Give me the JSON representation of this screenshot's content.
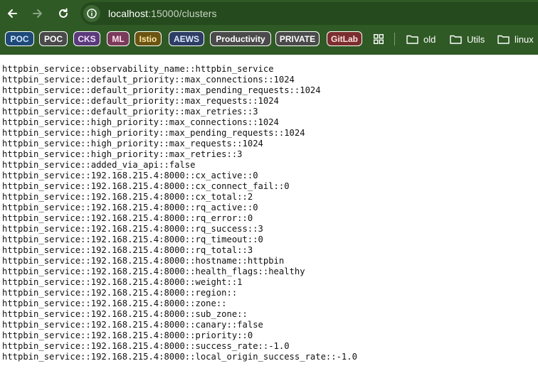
{
  "browser": {
    "url_host": "localhost",
    "url_path": ":15000/clusters",
    "bookmarks": [
      {
        "label": "POC",
        "bg": "#1f4a78",
        "fg": "#cfe3ff"
      },
      {
        "label": "POC",
        "bg": "#4a4a4a",
        "fg": "#ffffff"
      },
      {
        "label": "CKS",
        "bg": "#5a3a7a",
        "fg": "#f0e0ff"
      },
      {
        "label": "ML",
        "bg": "#7a3a5a",
        "fg": "#ffe0f0"
      },
      {
        "label": "Istio",
        "bg": "#6b5412",
        "fg": "#ffe7a6"
      },
      {
        "label": "AEWS",
        "bg": "#2d3d63",
        "fg": "#dfe8ff"
      },
      {
        "label": "Productivity",
        "bg": "#4a4a4a",
        "fg": "#ffffff"
      },
      {
        "label": "PRIVATE",
        "bg": "#4a4a4a",
        "fg": "#ffffff"
      },
      {
        "label": "GitLab",
        "bg": "#7a2e2e",
        "fg": "#ffe0e0"
      }
    ],
    "folders": [
      {
        "label": "old"
      },
      {
        "label": "Utils"
      },
      {
        "label": "linux"
      }
    ],
    "icons": [
      "back-arrow-icon",
      "forward-arrow-icon",
      "reload-icon",
      "site-info-icon",
      "apps-grid-icon",
      "folder-icon"
    ]
  },
  "page": {
    "lines": [
      "httpbin_service::observability_name::httpbin_service",
      "httpbin_service::default_priority::max_connections::1024",
      "httpbin_service::default_priority::max_pending_requests::1024",
      "httpbin_service::default_priority::max_requests::1024",
      "httpbin_service::default_priority::max_retries::3",
      "httpbin_service::high_priority::max_connections::1024",
      "httpbin_service::high_priority::max_pending_requests::1024",
      "httpbin_service::high_priority::max_requests::1024",
      "httpbin_service::high_priority::max_retries::3",
      "httpbin_service::added_via_api::false",
      "httpbin_service::192.168.215.4:8000::cx_active::0",
      "httpbin_service::192.168.215.4:8000::cx_connect_fail::0",
      "httpbin_service::192.168.215.4:8000::cx_total::2",
      "httpbin_service::192.168.215.4:8000::rq_active::0",
      "httpbin_service::192.168.215.4:8000::rq_error::0",
      "httpbin_service::192.168.215.4:8000::rq_success::3",
      "httpbin_service::192.168.215.4:8000::rq_timeout::0",
      "httpbin_service::192.168.215.4:8000::rq_total::3",
      "httpbin_service::192.168.215.4:8000::hostname::httpbin",
      "httpbin_service::192.168.215.4:8000::health_flags::healthy",
      "httpbin_service::192.168.215.4:8000::weight::1",
      "httpbin_service::192.168.215.4:8000::region::",
      "httpbin_service::192.168.215.4:8000::zone::",
      "httpbin_service::192.168.215.4:8000::sub_zone::",
      "httpbin_service::192.168.215.4:8000::canary::false",
      "httpbin_service::192.168.215.4:8000::priority::0",
      "httpbin_service::192.168.215.4:8000::success_rate::-1.0",
      "httpbin_service::192.168.215.4:8000::local_origin_success_rate::-1.0"
    ]
  }
}
